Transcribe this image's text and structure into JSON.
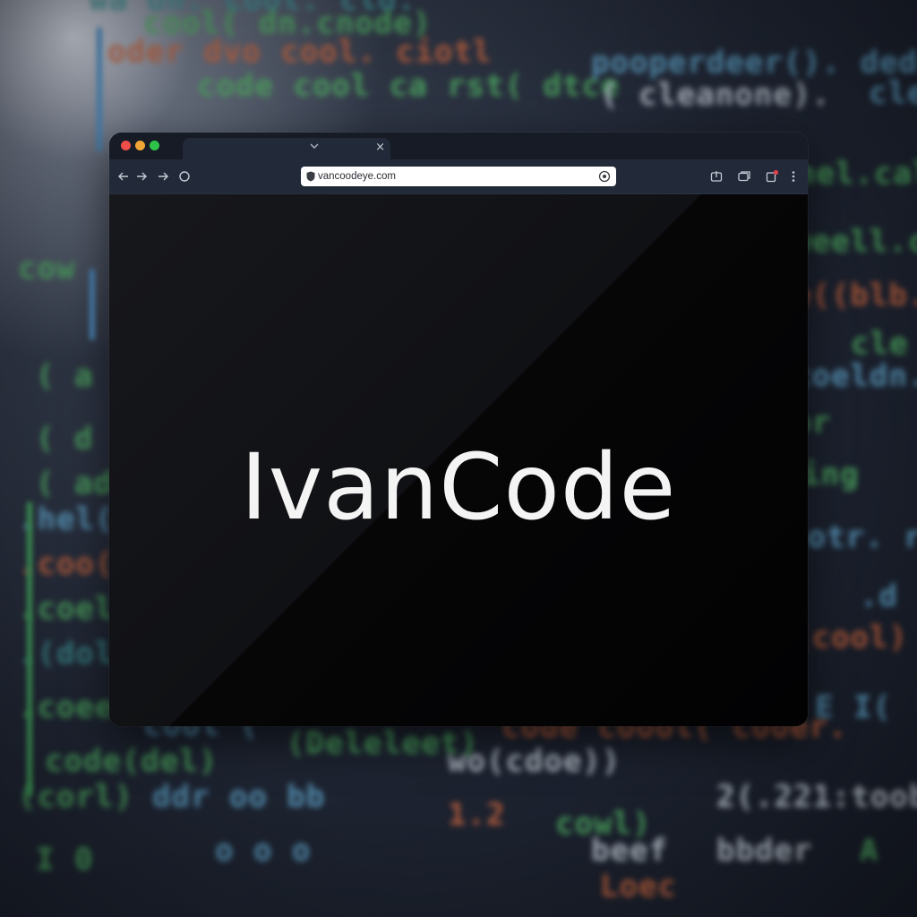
{
  "browser": {
    "tab": {
      "close_label": "×"
    },
    "address_bar": {
      "url": "vancoodeye.com"
    }
  },
  "page": {
    "brand_name": "IvanCode"
  },
  "colors": {
    "window_background": "#050506",
    "tabbar_background": "#161b26",
    "toolbar_background": "#222938",
    "brand_text": "#f4f4f4",
    "traffic_red": "#ee4e4a",
    "traffic_yellow": "#f1a537",
    "traffic_green": "#2fc24a"
  },
  "icons": {
    "back": "arrow-left-icon",
    "forward": "arrow-right-icon",
    "forward_secondary": "arrow-right-icon",
    "reload": "circle-icon",
    "share": "share-icon",
    "tabs": "tabs-icon",
    "extensions": "extensions-icon",
    "menu": "kebab-menu-icon"
  }
}
